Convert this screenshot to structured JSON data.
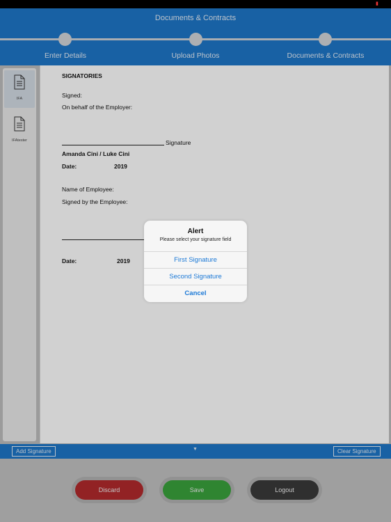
{
  "header": {
    "title": "Documents & Contracts",
    "steps": [
      {
        "label": "Enter Details"
      },
      {
        "label": "Upload Photos"
      },
      {
        "label": "Documents & Contracts"
      }
    ]
  },
  "sidebar": {
    "items": [
      {
        "label": "IFA",
        "icon": "document-icon",
        "active": true
      },
      {
        "label": "IFAtester",
        "icon": "document-icon",
        "active": false
      }
    ]
  },
  "document": {
    "heading": "SIGNATORIES",
    "signed": "Signed:",
    "on_behalf": "On behalf of the Employer:",
    "signature_label": "Signature",
    "employer_names": "Amanda Cini / Luke Cini",
    "date_label_1": "Date:",
    "year_1": "2019",
    "employee_name": "Name of Employee:",
    "signed_by_employee": "Signed by the Employee:",
    "date_label_2": "Date:",
    "year_2": "2019"
  },
  "alert": {
    "title": "Alert",
    "message": "Please select your signature field",
    "buttons": {
      "first": "First Signature",
      "second": "Second Signature",
      "cancel": "Cancel"
    }
  },
  "toolbar": {
    "add_signature": "Add Signature",
    "arrow": "▼",
    "clear_signature": "Clear Signature"
  },
  "footer": {
    "discard": "Discard",
    "save": "Save",
    "logout": "Logout"
  },
  "colors": {
    "accent": "#1e77c8",
    "discard": "#b22a2d",
    "save": "#3aa33c",
    "logout": "#3a3a3a",
    "alert_button": "#1a78d6"
  }
}
